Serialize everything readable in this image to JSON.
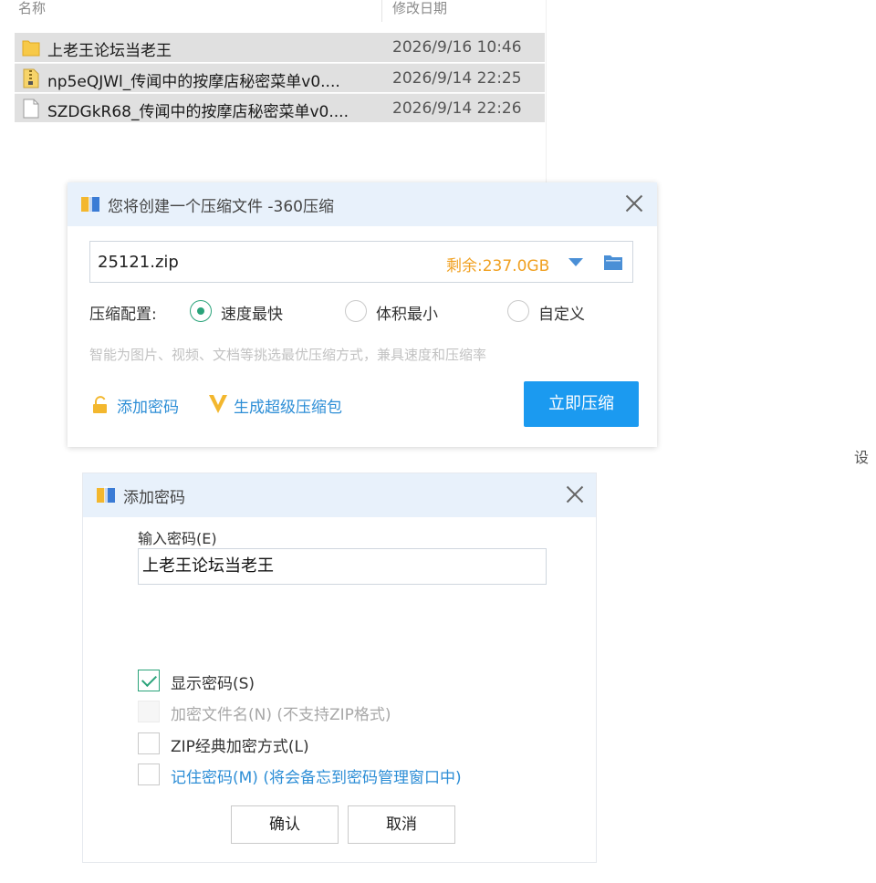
{
  "explorer": {
    "columns": {
      "name": "名称",
      "modified": "修改日期"
    },
    "files": [
      {
        "name": "上老王论坛当老王",
        "date": "2026/9/16 10:46",
        "icon": "folder-icon"
      },
      {
        "name": "np5eQJWl_传闻中的按摩店秘密菜单v0....",
        "date": "2026/9/14 22:25",
        "icon": "zip-icon"
      },
      {
        "name": "SZDGkR68_传闻中的按摩店秘密菜单v0....",
        "date": "2026/9/14 22:26",
        "icon": "document-icon"
      }
    ]
  },
  "compress_dialog": {
    "title": "您将创建一个压缩文件 -360压缩",
    "path_value": "25121.zip",
    "free_space": "剩余:237.0GB",
    "config_label": "压缩配置:",
    "options": [
      {
        "label": "速度最快",
        "selected": true
      },
      {
        "label": "体积最小",
        "selected": false
      },
      {
        "label": "自定义",
        "selected": false
      }
    ],
    "hint": "智能为图片、视频、文档等挑选最优压缩方式，兼具速度和压缩率",
    "add_password": "添加密码",
    "super_package": "生成超级压缩包",
    "compress_now": "立即压缩"
  },
  "password_dialog": {
    "title": "添加密码",
    "input_label": "输入密码(E)",
    "password_value": "上老王论坛当老王",
    "options": [
      {
        "label": "显示密码(S)",
        "checked": true,
        "enabled": true
      },
      {
        "label": "加密文件名(N) (不支持ZIP格式)",
        "checked": false,
        "enabled": false
      },
      {
        "label": "ZIP经典加密方式(L)",
        "checked": false,
        "enabled": true
      },
      {
        "label": "记住密码(M) (将会备忘到密码管理窗口中)",
        "checked": false,
        "enabled": true
      }
    ],
    "confirm": "确认",
    "cancel": "取消"
  },
  "edge_text": "设",
  "colors": {
    "title_bar": "#e8f1fb",
    "primary_button": "#1b9af0",
    "free_space": "#f0a020",
    "link": "#2d8ed6",
    "radio_check": "#2aa37a",
    "hint": "#c2c2c2"
  }
}
